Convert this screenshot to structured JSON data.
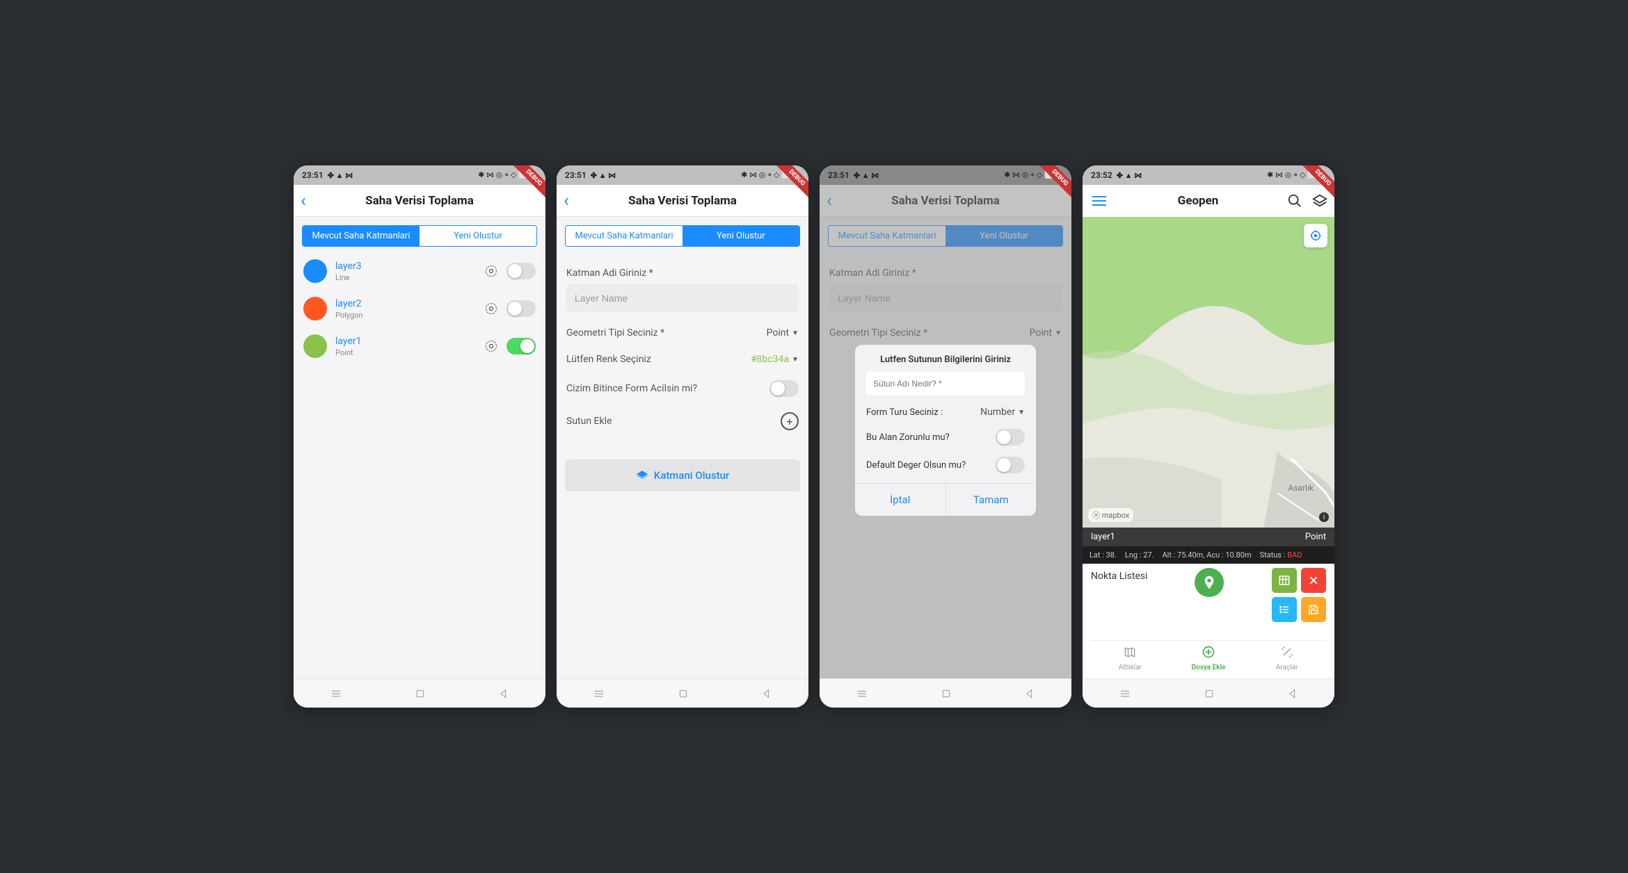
{
  "status": {
    "times": [
      "23:51",
      "23:51",
      "23:51",
      "23:52"
    ],
    "left_icons": "✤ ▲ ⋈",
    "right_icons": "✱ ⋈ ◎ ⌖ ◇ ⬜ ⬚"
  },
  "debug": "DEBUG",
  "header": {
    "title": "Saha Verisi Toplama",
    "map_title": "Geopen"
  },
  "tabs": {
    "existing": "Mevcut Saha Katmanlari",
    "create": "Yeni Olustur"
  },
  "layers": [
    {
      "name": "layer3",
      "type": "Line",
      "color": "#1a8cff",
      "on": false
    },
    {
      "name": "layer2",
      "type": "Polygon",
      "color": "#ff5722",
      "on": false
    },
    {
      "name": "layer1",
      "type": "Point",
      "color": "#8bc34a",
      "on": true
    }
  ],
  "form": {
    "name_label": "Katman Adi Giriniz *",
    "name_placeholder": "Layer Name",
    "geom_label": "Geometri Tipi Seciniz *",
    "geom_value": "Point",
    "color_label": "Lütfen Renk Seçiniz",
    "color_value": "#8bc34a",
    "form_open_label": "Cizim Bitince Form Acilsin mi?",
    "add_col_label": "Sutun Ekle",
    "create_btn": "Katmani Olustur"
  },
  "dialog": {
    "title": "Lutfen Sutunun Bilgilerini Giriniz",
    "col_placeholder": "Sütun Adı Nedir? *",
    "form_type_label": "Form Turu Seciniz :",
    "form_type_value": "Number",
    "required_label": "Bu Alan Zorunlu mu?",
    "default_label": "Default Deger Olsun mu?",
    "cancel": "İptal",
    "ok": "Tamam"
  },
  "map": {
    "place": "Asarlık",
    "badge": "ⓞ mapbox",
    "layer_name": "layer1",
    "geom": "Point",
    "lat": "Lat : 38.",
    "lng": "Lng : 27.",
    "alt": "Alt : 75.40m, Acu : 10.80m",
    "status_label": "Status :",
    "status_value": "BAD",
    "panel_title": "Nokta Listesi",
    "bottom_nav": {
      "basemaps": "Altlıklar",
      "addfile": "Dosya Ekle",
      "tools": "Araçlar"
    }
  }
}
